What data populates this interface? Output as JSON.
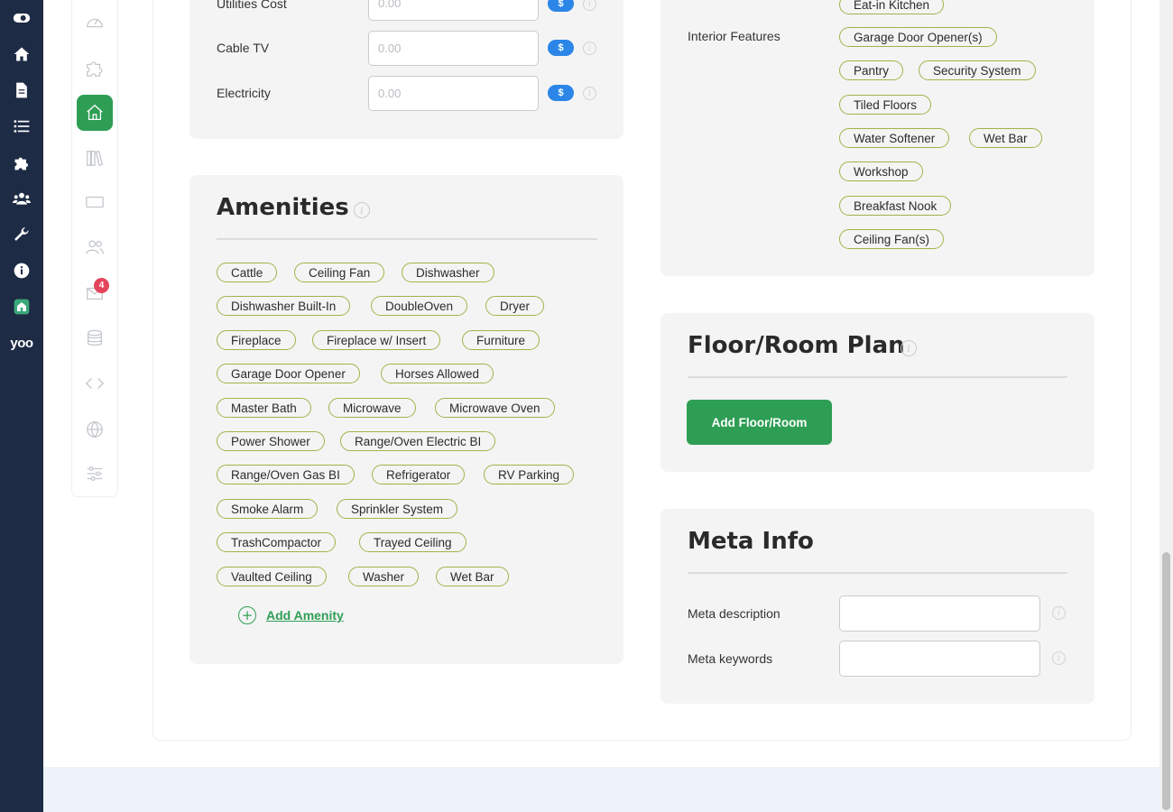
{
  "rail": {
    "icons": [
      "toggle-icon",
      "home-icon",
      "document-icon",
      "list-icon",
      "puzzle-icon",
      "users-icon",
      "wrench-icon",
      "info-icon",
      "house-app-icon",
      "yoo-logo-icon"
    ],
    "logo_text": "yoo"
  },
  "subbar": {
    "icons": [
      "gauge-icon",
      "puzzle-outline-icon",
      "home-outline-icon",
      "books-icon",
      "card-icon",
      "people-icon",
      "mail-icon",
      "database-icon",
      "code-icon",
      "globe-icon",
      "sliders-icon"
    ],
    "active": "home-outline-icon",
    "mail_badge": "4"
  },
  "costs": {
    "rows": [
      {
        "label": "Utilities Cost",
        "placeholder": "0.00",
        "currency": "$"
      },
      {
        "label": "Cable TV",
        "placeholder": "0.00",
        "currency": "$"
      },
      {
        "label": "Electricity",
        "placeholder": "0.00",
        "currency": "$"
      }
    ]
  },
  "amenities": {
    "title": "Amenities",
    "items": [
      "Cattle",
      "Ceiling Fan",
      "Dishwasher",
      "Dishwasher Built-In",
      "DoubleOven",
      "Dryer",
      "Fireplace",
      "Fireplace w/ Insert",
      "Furniture",
      "Garage Door Opener",
      "Horses Allowed",
      "Master Bath",
      "Microwave",
      "Microwave Oven",
      "Power Shower",
      "Range/Oven Electric BI",
      "Range/Oven Gas BI",
      "Refrigerator",
      "RV Parking",
      "Smoke Alarm",
      "Sprinkler System",
      "TrashCompactor",
      "Trayed Ceiling",
      "Vaulted Ceiling",
      "Washer",
      "Wet Bar"
    ],
    "add_label": "Add Amenity"
  },
  "interior": {
    "label": "Interior Features",
    "items": [
      "Eat-in Kitchen",
      "Garage Door Opener(s)",
      "Pantry",
      "Security System",
      "Tiled Floors",
      "Water Softener",
      "Wet Bar",
      "Workshop",
      "Breakfast Nook",
      "Ceiling Fan(s)"
    ]
  },
  "floor_plan": {
    "title": "Floor/Room Plan",
    "button_label": "Add Floor/Room"
  },
  "meta": {
    "title": "Meta Info",
    "description_label": "Meta description",
    "keywords_label": "Meta keywords"
  },
  "colors": {
    "rail": "#1e2b45",
    "accent_green": "#2e9e55",
    "chip_border": "#9db54a",
    "currency_blue": "#2b86e8",
    "badge_red": "#e5455c"
  }
}
